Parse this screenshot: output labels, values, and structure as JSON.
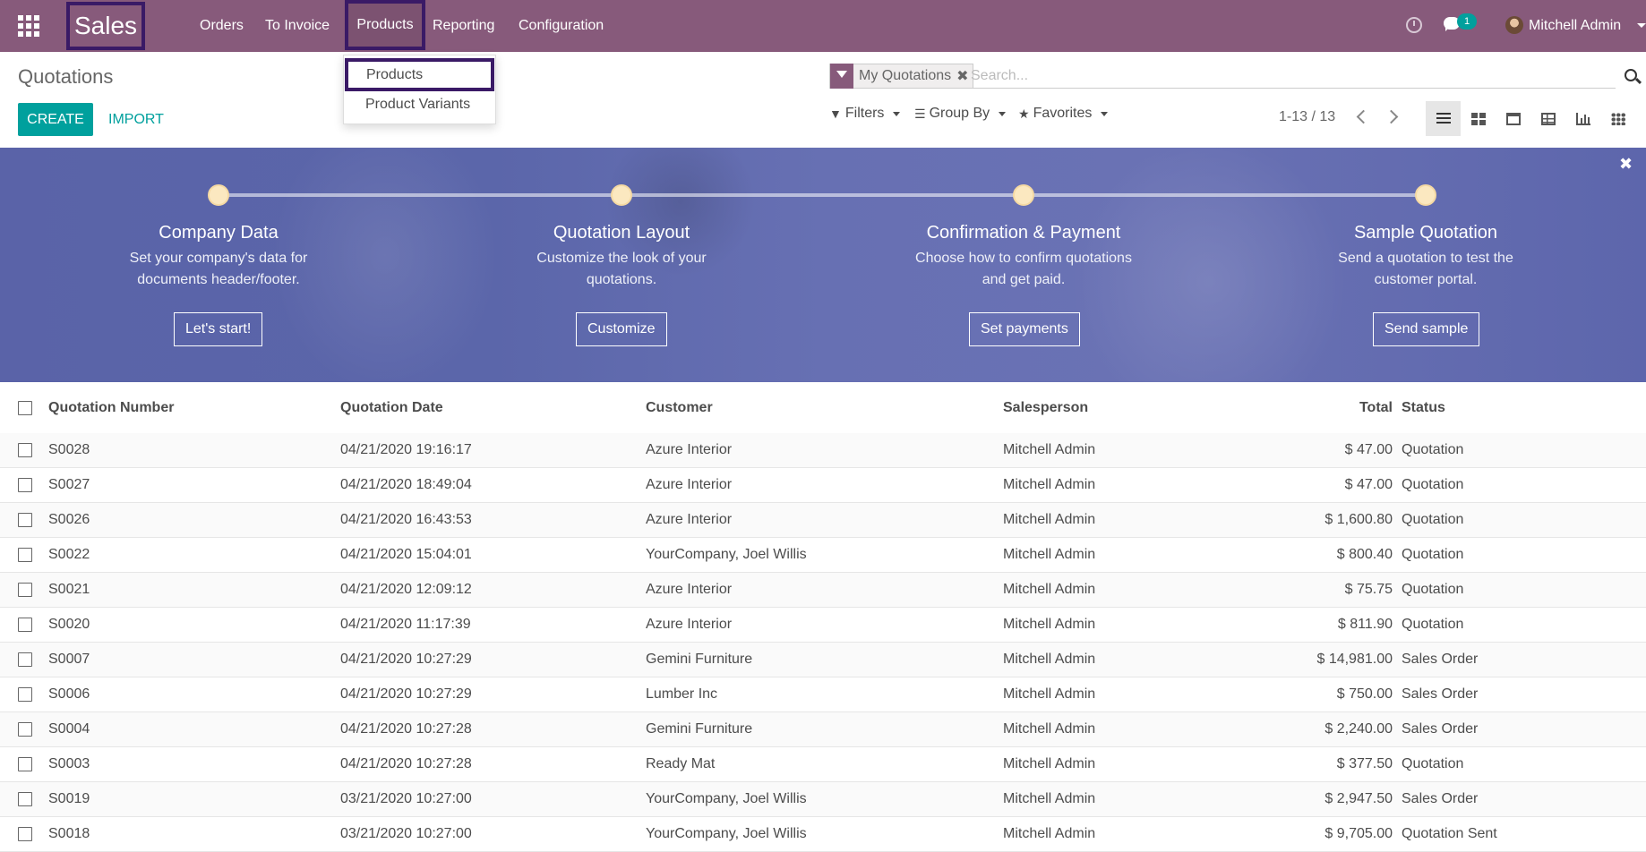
{
  "navbar": {
    "app_name": "Sales",
    "menu": [
      "Orders",
      "To Invoice",
      "Products",
      "Reporting",
      "Configuration"
    ],
    "chat_count": "1",
    "user_name": "Mitchell Admin"
  },
  "products_dropdown": [
    "Products",
    "Product Variants"
  ],
  "control_panel": {
    "title": "Quotations",
    "create_label": "CREATE",
    "import_label": "IMPORT",
    "facet_label": "My Quotations",
    "search_placeholder": "Search...",
    "filters_label": "Filters",
    "group_by_label": "Group By",
    "favorites_label": "Favorites",
    "pager": "1-13 / 13"
  },
  "onboarding": {
    "steps": [
      {
        "title": "Company Data",
        "desc1": "Set your company's data for",
        "desc2": "documents header/footer.",
        "button": "Let's start!"
      },
      {
        "title": "Quotation Layout",
        "desc1": "Customize the look of your",
        "desc2": "quotations.",
        "button": "Customize"
      },
      {
        "title": "Confirmation & Payment",
        "desc1": "Choose how to confirm quotations",
        "desc2": "and get paid.",
        "button": "Set payments"
      },
      {
        "title": "Sample Quotation",
        "desc1": "Send a quotation to test the",
        "desc2": "customer portal.",
        "button": "Send sample"
      }
    ]
  },
  "table": {
    "columns": [
      "Quotation Number",
      "Quotation Date",
      "Customer",
      "Salesperson",
      "Total",
      "Status"
    ],
    "rows": [
      [
        "S0028",
        "04/21/2020 19:16:17",
        "Azure Interior",
        "Mitchell Admin",
        "$ 47.00",
        "Quotation"
      ],
      [
        "S0027",
        "04/21/2020 18:49:04",
        "Azure Interior",
        "Mitchell Admin",
        "$ 47.00",
        "Quotation"
      ],
      [
        "S0026",
        "04/21/2020 16:43:53",
        "Azure Interior",
        "Mitchell Admin",
        "$ 1,600.80",
        "Quotation"
      ],
      [
        "S0022",
        "04/21/2020 15:04:01",
        "YourCompany, Joel Willis",
        "Mitchell Admin",
        "$ 800.40",
        "Quotation"
      ],
      [
        "S0021",
        "04/21/2020 12:09:12",
        "Azure Interior",
        "Mitchell Admin",
        "$ 75.75",
        "Quotation"
      ],
      [
        "S0020",
        "04/21/2020 11:17:39",
        "Azure Interior",
        "Mitchell Admin",
        "$ 811.90",
        "Quotation"
      ],
      [
        "S0007",
        "04/21/2020 10:27:29",
        "Gemini Furniture",
        "Mitchell Admin",
        "$ 14,981.00",
        "Sales Order"
      ],
      [
        "S0006",
        "04/21/2020 10:27:29",
        "Lumber Inc",
        "Mitchell Admin",
        "$ 750.00",
        "Sales Order"
      ],
      [
        "S0004",
        "04/21/2020 10:27:28",
        "Gemini Furniture",
        "Mitchell Admin",
        "$ 2,240.00",
        "Sales Order"
      ],
      [
        "S0003",
        "04/21/2020 10:27:28",
        "Ready Mat",
        "Mitchell Admin",
        "$ 377.50",
        "Quotation"
      ],
      [
        "S0019",
        "03/21/2020 10:27:00",
        "YourCompany, Joel Willis",
        "Mitchell Admin",
        "$ 2,947.50",
        "Sales Order"
      ],
      [
        "S0018",
        "03/21/2020 10:27:00",
        "YourCompany, Joel Willis",
        "Mitchell Admin",
        "$ 9,705.00",
        "Quotation Sent"
      ]
    ]
  },
  "colors": {
    "navbar": "#875a7b",
    "primary": "#00a09d",
    "highlight_border": "#3a1a66"
  }
}
